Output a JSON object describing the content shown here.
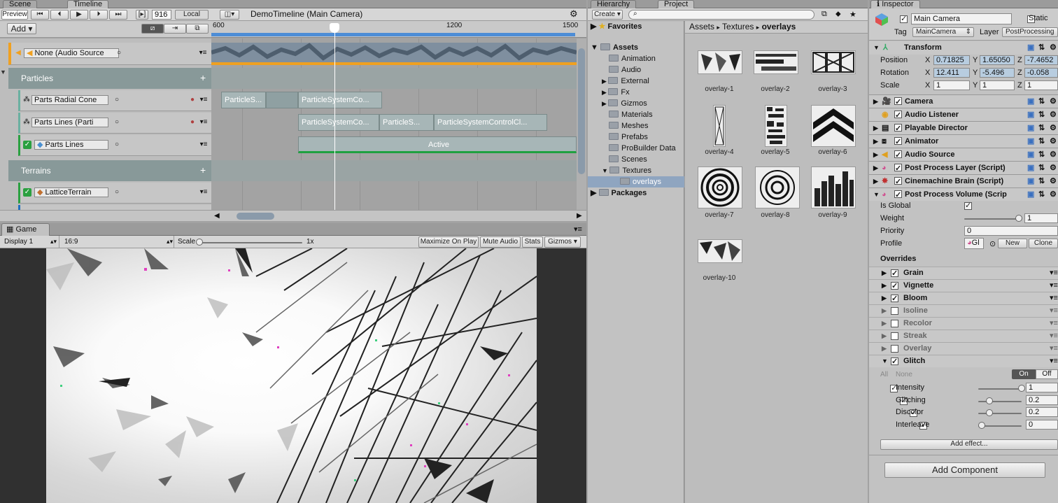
{
  "top_tabs": {
    "scene": "Scene",
    "timeline": "Timeline"
  },
  "timeline_toolbar": {
    "preview": "Preview",
    "frame": "916",
    "local": "Local",
    "title": "DemoTimeline (Main Camera)"
  },
  "timeline_header": {
    "add": "Add",
    "ruler": [
      "600",
      "1200",
      "1500"
    ]
  },
  "timeline_tracks": {
    "audio": "None (Audio Source",
    "group1": "Particles",
    "radial": "Parts Radial Cone",
    "lines": "Parts Lines (Parti",
    "lines_active": "Parts Lines",
    "group2": "Terrains",
    "terrain": "LatticeTerrain"
  },
  "timeline_clips": {
    "c1": "ParticleS...",
    "c2": "ParticleSystemCo...",
    "c3": "ParticleSystemCo...",
    "c4": "ParticleS...",
    "c5": "ParticleSystemControlCl...",
    "active": "Active"
  },
  "game": {
    "tab": "Game",
    "display": "Display 1",
    "aspect": "16:9",
    "scale_label": "Scale",
    "scale_value": "1x",
    "maximize": "Maximize On Play",
    "mute": "Mute Audio",
    "stats": "Stats",
    "gizmos": "Gizmos"
  },
  "project_tabs": {
    "hierarchy": "Hierarchy",
    "project": "Project"
  },
  "project_toolbar": {
    "create": "Create"
  },
  "project_tree": {
    "favorites": "Favorites",
    "assets": "Assets",
    "folders": [
      "Animation",
      "Audio",
      "External",
      "Fx",
      "Gizmos",
      "Materials",
      "Meshes",
      "Prefabs",
      "ProBuilder Data",
      "Scenes",
      "Textures"
    ],
    "selected": "overlays",
    "packages": "Packages"
  },
  "breadcrumb": {
    "a": "Assets",
    "b": "Textures",
    "c": "overlays"
  },
  "thumbs": [
    "overlay-1",
    "overlay-2",
    "overlay-3",
    "overlay-4",
    "overlay-5",
    "overlay-6",
    "overlay-7",
    "overlay-8",
    "overlay-9",
    "overlay-10"
  ],
  "inspector": {
    "tab": "Inspector",
    "name": "Main Camera",
    "static": "Static",
    "tag_label": "Tag",
    "tag_value": "MainCamera",
    "layer_label": "Layer",
    "layer_value": "PostProcessing",
    "transform": "Transform",
    "position": "Position",
    "rotation": "Rotation",
    "scale": "Scale",
    "axis_x": "X",
    "axis_y": "Y",
    "axis_z": "Z",
    "pos": [
      "0.71825",
      "1.65050",
      "-7.4652"
    ],
    "rot": [
      "12.411",
      "-5.496",
      "-0.058"
    ],
    "scl": [
      "1",
      "1",
      "1"
    ],
    "components": [
      "Camera",
      "Audio Listener",
      "Playable Director",
      "Animator",
      "Audio Source",
      "Post Process Layer (Script)",
      "Cinemachine Brain (Script)",
      "Post Process Volume (Scrip"
    ],
    "is_global": "Is Global",
    "weight": "Weight",
    "weight_value": "1",
    "weight_level": 1,
    "priority": "Priority",
    "priority_value": "0",
    "profile": "Profile",
    "profile_value": "Gl",
    "new": "New",
    "clone": "Clone",
    "overrides": "Overrides",
    "effects": [
      {
        "name": "Grain",
        "on": true
      },
      {
        "name": "Vignette",
        "on": true
      },
      {
        "name": "Bloom",
        "on": true
      },
      {
        "name": "Isoline",
        "on": false
      },
      {
        "name": "Recolor",
        "on": false
      },
      {
        "name": "Streak",
        "on": false
      },
      {
        "name": "Overlay",
        "on": false
      },
      {
        "name": "Glitch",
        "on": true
      }
    ],
    "all": "All",
    "none": "None",
    "on": "On",
    "off": "Off",
    "params": [
      {
        "name": "Intensity",
        "value": "1",
        "level": 1
      },
      {
        "name": "Glitching",
        "value": "0.2",
        "level": 0.2
      },
      {
        "name": "Discolor",
        "value": "0.2",
        "level": 0.2
      },
      {
        "name": "Interleave",
        "value": "0",
        "level": 0
      }
    ],
    "add_effect": "Add effect...",
    "add_component": "Add Component"
  }
}
